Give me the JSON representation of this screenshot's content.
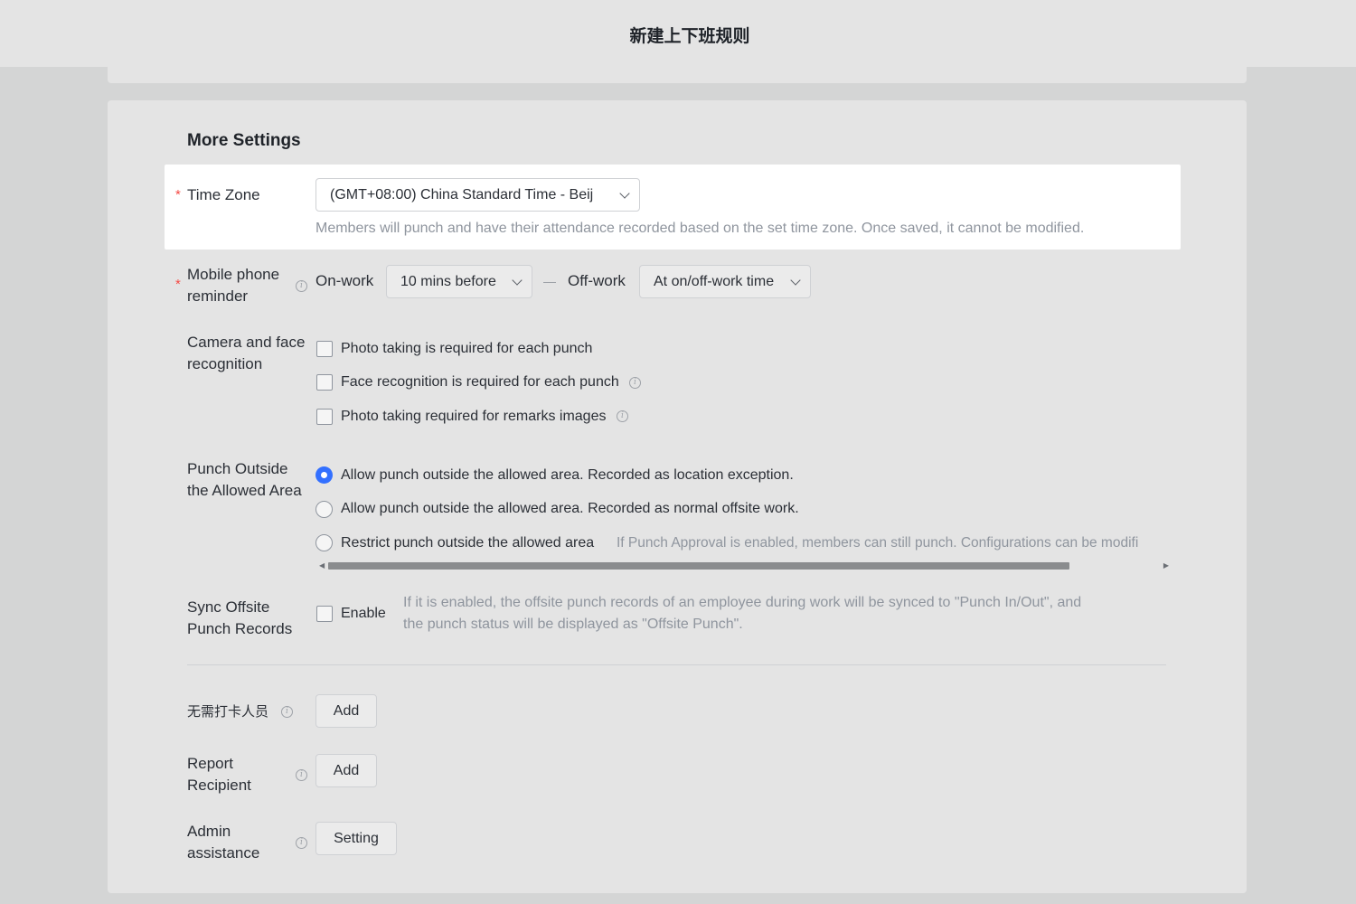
{
  "window": {
    "title": "新建上下班规则"
  },
  "section": {
    "title": "More Settings"
  },
  "time_zone": {
    "label": "Time Zone",
    "required_mark": "*",
    "value": "(GMT+08:00) China Standard Time - Beij",
    "hint": "Members will punch and have their attendance recorded based on the set time zone. Once saved, it cannot be modified."
  },
  "mobile_reminder": {
    "label_line1": "Mobile phone",
    "label_line2": "reminder",
    "required_mark": "*",
    "on_work_label": "On-work",
    "on_work_value": "10 mins before",
    "off_work_label": "Off-work",
    "off_work_value": "At on/off-work time"
  },
  "camera": {
    "label_line1": "Camera and face",
    "label_line2": "recognition",
    "options": [
      {
        "label": "Photo taking is required for each punch",
        "checked": false
      },
      {
        "label": "Face recognition is required for each punch",
        "checked": false
      },
      {
        "label": "Photo taking required for remarks images",
        "checked": false
      }
    ]
  },
  "punch_outside": {
    "label_line1": "Punch Outside",
    "label_line2": "the Allowed Area",
    "options": [
      {
        "label": "Allow punch outside the allowed area. Recorded as location exception.",
        "selected": true
      },
      {
        "label": "Allow punch outside the allowed area. Recorded as normal offsite work.",
        "selected": false
      },
      {
        "label": "Restrict punch outside the allowed area",
        "selected": false
      }
    ],
    "restrict_hint": "If Punch Approval is enabled, members can still punch. Configurations can be modifi"
  },
  "sync_offsite": {
    "label_line1": "Sync Offsite",
    "label_line2": "Punch Records",
    "enable_label": "Enable",
    "enabled": false,
    "hint_line1": "If it is enabled, the offsite punch records of an employee during work will be synced to \"Punch In/Out\", and",
    "hint_line2": "the punch status will be displayed as \"Offsite Punch\"."
  },
  "no_punch": {
    "label": "无需打卡人员",
    "button": "Add"
  },
  "report_recipient": {
    "label_line1": "Report",
    "label_line2": "Recipient",
    "button": "Add"
  },
  "admin_assistance": {
    "label_line1": "Admin",
    "label_line2": "assistance",
    "button": "Setting"
  },
  "colors": {
    "accent": "#3370ff",
    "required": "#f54a45",
    "hint": "#8f959e"
  },
  "icons": {
    "info": "info-circle-icon",
    "dropdown": "chevron-down-icon"
  }
}
